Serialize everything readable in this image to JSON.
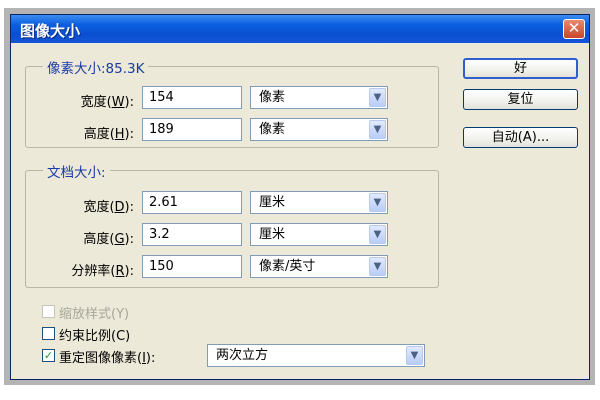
{
  "window": {
    "title": "图像大小",
    "close_glyph": "✕"
  },
  "pixel_dims": {
    "legend": "像素大小:85.3K",
    "width": {
      "label": "宽度(",
      "key": "W",
      "suffix": "):",
      "value": "154",
      "unit": "像素"
    },
    "height": {
      "label": "高度(",
      "key": "H",
      "suffix": "):",
      "value": "189",
      "unit": "像素"
    }
  },
  "document_size": {
    "legend": "文档大小:",
    "width": {
      "label": "宽度(",
      "key": "D",
      "suffix": "):",
      "value": "2.61",
      "unit": "厘米"
    },
    "height": {
      "label": "高度(",
      "key": "G",
      "suffix": "):",
      "value": "3.2",
      "unit": "厘米"
    },
    "resolution": {
      "label": "分辨率(",
      "key": "R",
      "suffix": "):",
      "value": "150",
      "unit": "像素/英寸"
    }
  },
  "buttons": {
    "ok": "好",
    "reset": "复位",
    "auto": "自动(A)..."
  },
  "options": {
    "scale_styles": {
      "label": "缩放样式(Y)",
      "checked": false,
      "enabled": false
    },
    "constrain": {
      "label": "约束比例(C)",
      "checked": false,
      "enabled": true
    },
    "resample": {
      "label": "重定图像像素(",
      "key": "I",
      "suffix": "):",
      "checked": true,
      "enabled": true
    },
    "resample_method": "两次立方"
  },
  "icons": {
    "dropdown_arrow": "chevron-down-icon",
    "check_mark": "✓"
  }
}
